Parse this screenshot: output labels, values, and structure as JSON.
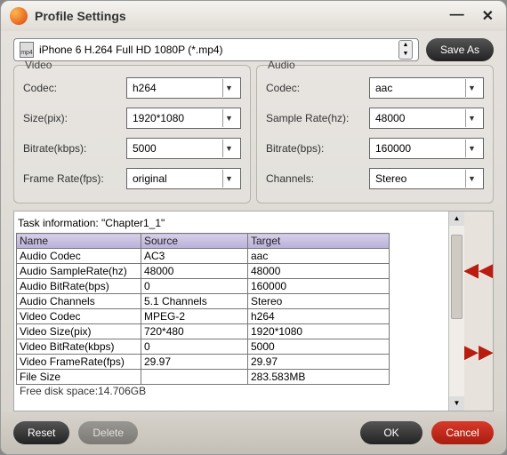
{
  "window": {
    "title": "Profile Settings"
  },
  "profile_combo": "iPhone 6 H.264 Full HD 1080P (*.mp4)",
  "save_as": "Save As",
  "video": {
    "legend": "Video",
    "codec_label": "Codec:",
    "codec_value": "h264",
    "size_label": "Size(pix):",
    "size_value": "1920*1080",
    "bitrate_label": "Bitrate(kbps):",
    "bitrate_value": "5000",
    "fps_label": "Frame Rate(fps):",
    "fps_value": "original"
  },
  "audio": {
    "legend": "Audio",
    "codec_label": "Codec:",
    "codec_value": "aac",
    "sample_label": "Sample Rate(hz):",
    "sample_value": "48000",
    "bitrate_label": "Bitrate(bps):",
    "bitrate_value": "160000",
    "channels_label": "Channels:",
    "channels_value": "Stereo"
  },
  "task": {
    "info": "Task information: \"Chapter1_1\"",
    "headers": {
      "name": "Name",
      "source": "Source",
      "target": "Target"
    },
    "rows": [
      {
        "name": "Audio Codec",
        "source": "AC3",
        "target": "aac"
      },
      {
        "name": "Audio SampleRate(hz)",
        "source": "48000",
        "target": "48000"
      },
      {
        "name": "Audio BitRate(bps)",
        "source": "0",
        "target": "160000"
      },
      {
        "name": "Audio Channels",
        "source": "5.1 Channels",
        "target": "Stereo"
      },
      {
        "name": "Video Codec",
        "source": "MPEG-2",
        "target": "h264"
      },
      {
        "name": "Video Size(pix)",
        "source": "720*480",
        "target": "1920*1080"
      },
      {
        "name": "Video BitRate(kbps)",
        "source": "0",
        "target": "5000"
      },
      {
        "name": "Video FrameRate(fps)",
        "source": "29.97",
        "target": "29.97"
      },
      {
        "name": "File Size",
        "source": "",
        "target": "283.583MB"
      }
    ],
    "free_disk": "Free disk space:14.706GB"
  },
  "buttons": {
    "reset": "Reset",
    "delete": "Delete",
    "ok": "OK",
    "cancel": "Cancel"
  },
  "icons": {
    "mp4": "mp4"
  }
}
